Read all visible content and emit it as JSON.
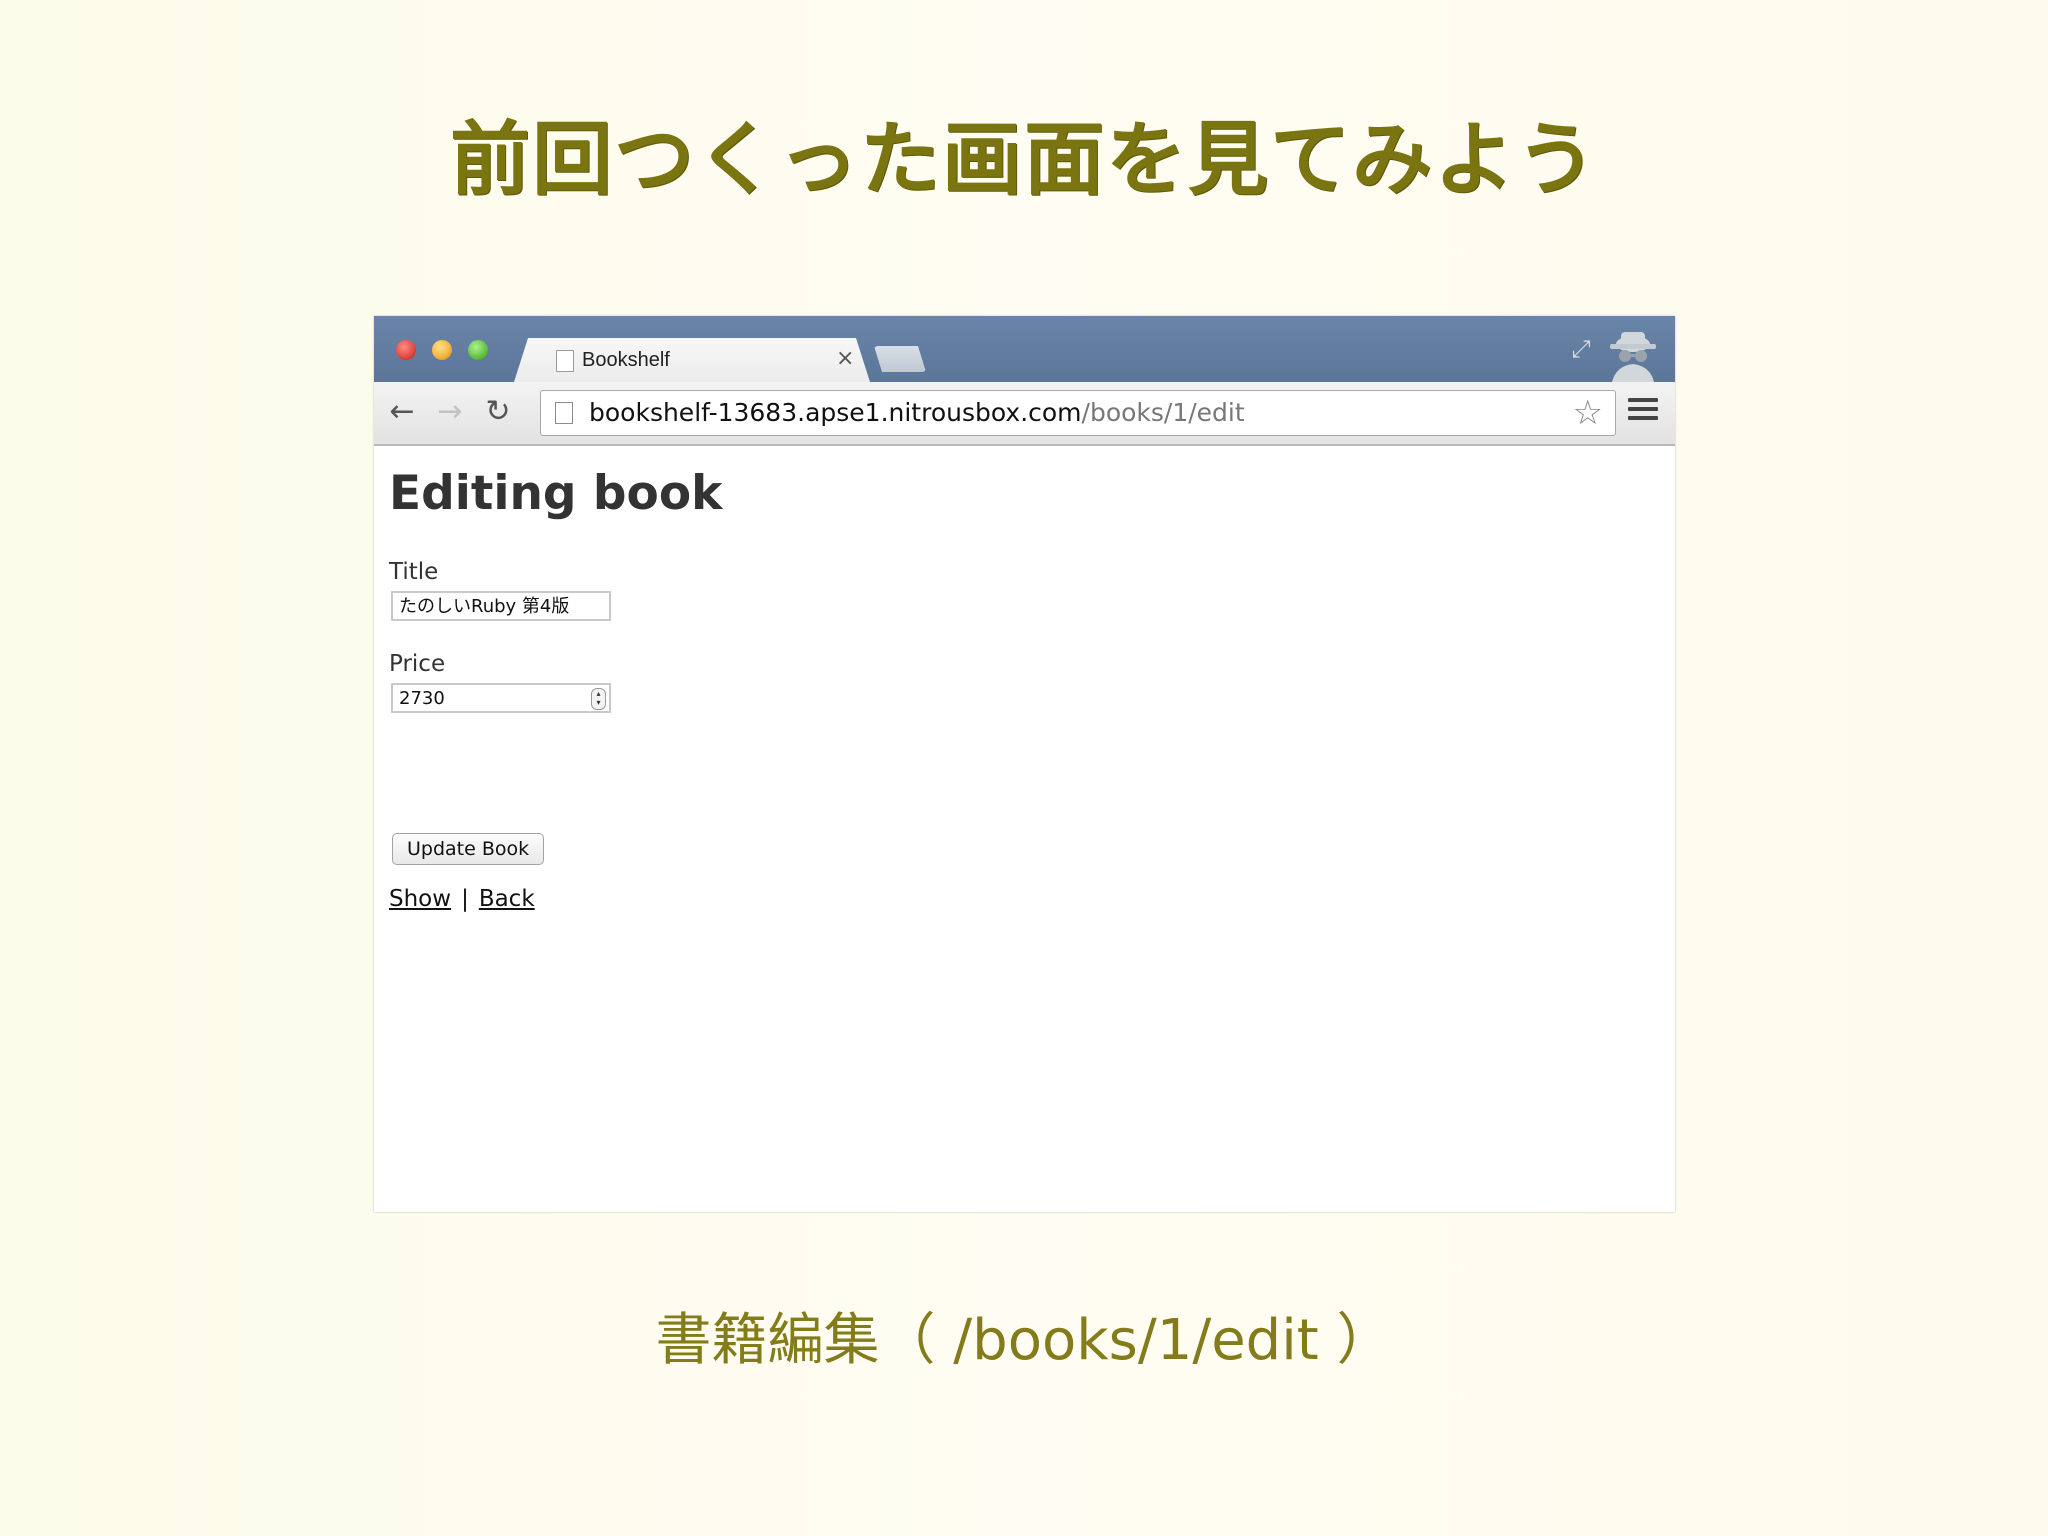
{
  "slide": {
    "title": "前回つくった画面を見てみよう",
    "caption": "書籍編集（ /books/1/edit ）"
  },
  "browser": {
    "tab_title": "Bookshelf",
    "tab_close": "×",
    "url_host": "bookshelf-13683.apse1.nitrousbox.com",
    "url_path": "/books/1/edit",
    "icons": [
      "back-arrow-icon",
      "forward-arrow-icon",
      "reload-icon",
      "page-icon",
      "star-icon",
      "menu-icon",
      "fullscreen-icon",
      "incognito-icon"
    ]
  },
  "page": {
    "heading": "Editing book",
    "title_label": "Title",
    "title_value": "たのしいRuby 第4版",
    "price_label": "Price",
    "price_value": "2730",
    "submit_label": "Update Book",
    "show_link": "Show",
    "separator": "|",
    "back_link": "Back"
  },
  "colors": {
    "title_text": "#7a7510",
    "caption_text": "#847c1a",
    "titlebar": "#6482a6"
  }
}
